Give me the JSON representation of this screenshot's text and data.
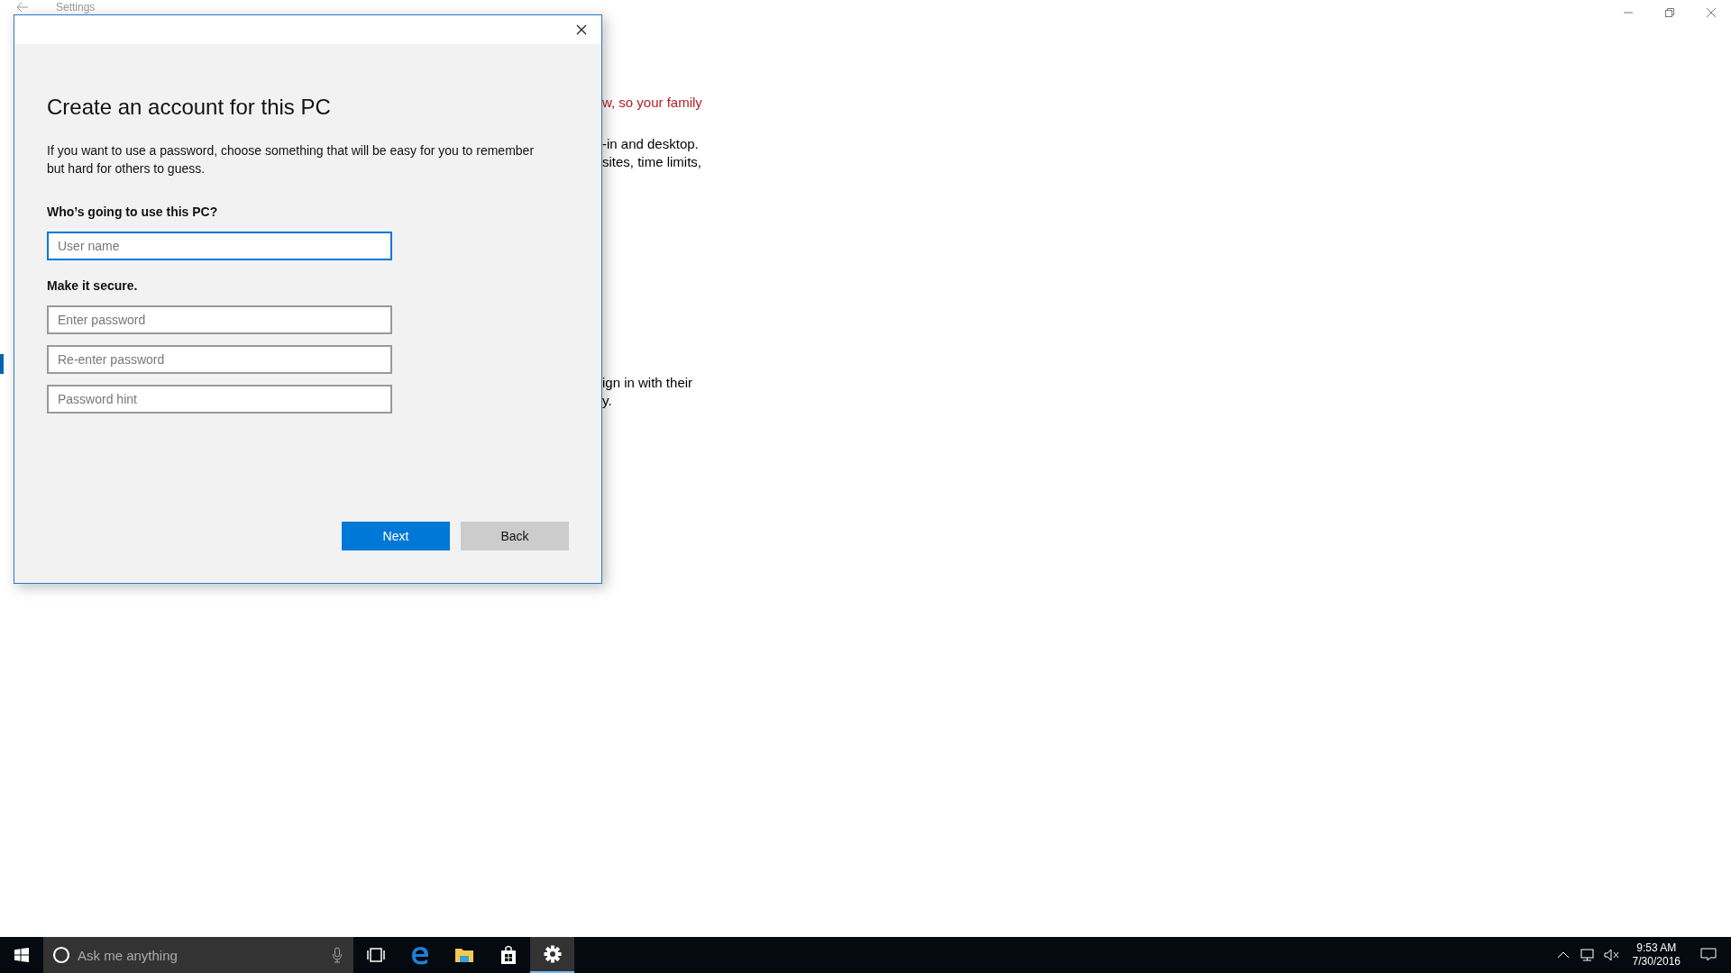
{
  "window": {
    "title": "Settings"
  },
  "background_text": [
    {
      "kind": "link",
      "lines": [
        "w, so your family"
      ]
    },
    {
      "kind": "plain",
      "lines": [
        "-in and desktop.",
        "sites, time limits,"
      ]
    },
    {
      "kind": "plain",
      "lines": [
        "ign in with their",
        "y."
      ]
    }
  ],
  "dialog": {
    "title": "Create an account for this PC",
    "intro": "If you want to use a password, choose something that will be easy for you to remember but hard for others to guess.",
    "sections": [
      {
        "label": "Who’s going to use this PC?",
        "fields": [
          {
            "placeholder": "User name",
            "focused": true
          }
        ]
      },
      {
        "label": "Make it secure.",
        "fields": [
          {
            "placeholder": "Enter password",
            "focused": false
          },
          {
            "placeholder": "Re-enter password",
            "focused": false
          },
          {
            "placeholder": "Password hint",
            "focused": false
          }
        ]
      }
    ],
    "buttons": [
      {
        "label": "Next",
        "kind": "primary"
      },
      {
        "label": "Back",
        "kind": "secondary"
      }
    ]
  },
  "taskbar": {
    "search": {
      "placeholder": "Ask me anything"
    },
    "apps": [
      {
        "kind": "taskview",
        "selected": false
      },
      {
        "kind": "edge",
        "selected": false
      },
      {
        "kind": "explorer",
        "selected": false
      },
      {
        "kind": "store",
        "selected": false
      },
      {
        "kind": "settings",
        "selected": true
      }
    ],
    "clock": {
      "time": "9:53 AM",
      "date": "7/30/2016"
    }
  }
}
